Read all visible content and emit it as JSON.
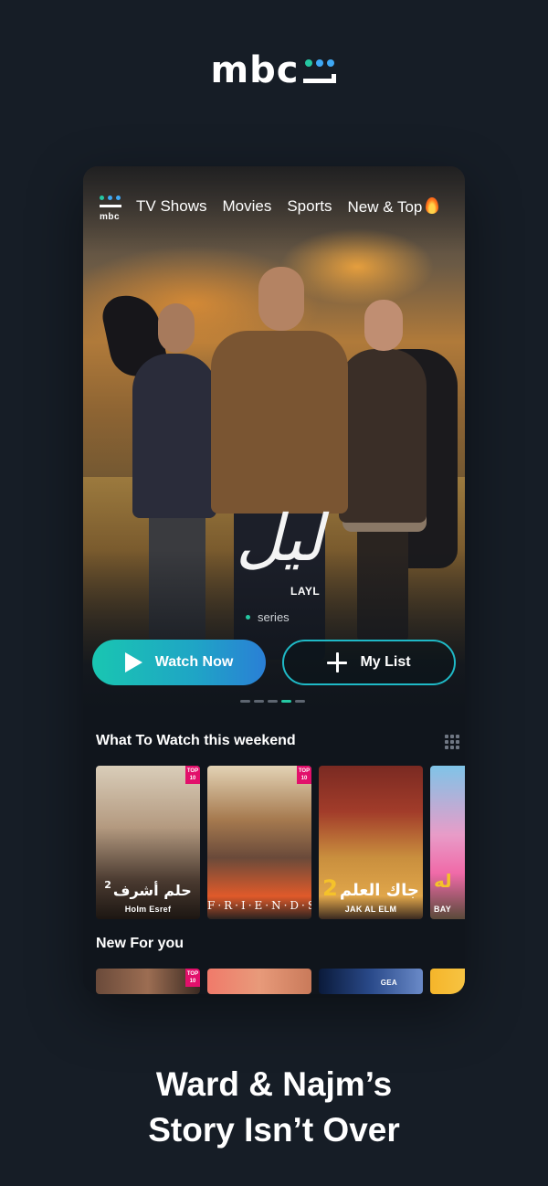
{
  "brand": {
    "wordmark": "mbc",
    "dot_colors": [
      "#25c7a2",
      "#3fa9f5",
      "#ffffff"
    ]
  },
  "nav": {
    "logo_text": "mbc",
    "items": [
      "TV Shows",
      "Movies",
      "Sports",
      "New & Top"
    ],
    "hot_icon": "fire-icon"
  },
  "hero": {
    "title_arabic": "ليل",
    "title_latin": "LAYL",
    "genre": "series",
    "watch_label": "Watch Now",
    "list_label": "My List",
    "pager": {
      "count": 5,
      "active_index": 3
    }
  },
  "sections": {
    "weekend_title": "What To Watch this weekend",
    "new_title": "New For you"
  },
  "weekend_posters": [
    {
      "arabic": "حلم أشرف",
      "number": "2",
      "caption": "Holm Esref",
      "badge": "TOP 10"
    },
    {
      "arabic": "",
      "number": "",
      "caption": "F·R·I·E·N·D·S",
      "badge": "TOP 10"
    },
    {
      "arabic": "جاك العلم",
      "number": "2",
      "caption": "JAK AL ELM",
      "badge": ""
    },
    {
      "arabic": "له",
      "number": "",
      "caption": "BAY",
      "badge": ""
    }
  ],
  "new_posters": [
    {
      "badge": "TOP 10",
      "label": ""
    },
    {
      "badge": "",
      "label": ""
    },
    {
      "badge": "",
      "label": "GEA"
    },
    {
      "badge": "",
      "label": ""
    }
  ],
  "tagline": {
    "line1": "Ward & Najm’s",
    "line2": "Story Isn’t Over"
  },
  "colors": {
    "background": "#161d26",
    "accent": "#25c7a2",
    "accent_blue": "#2a7fd6",
    "badge": "#e2106b"
  }
}
